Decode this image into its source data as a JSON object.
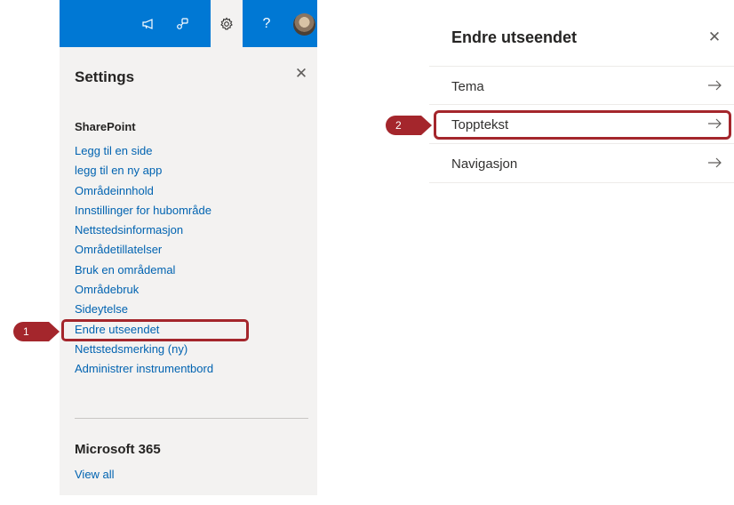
{
  "settings_panel": {
    "title": "Settings",
    "close_glyph": "✕",
    "toolbar": {
      "icons": [
        "megaphone-icon",
        "network-icon",
        "gear-icon",
        "help-icon",
        "avatar"
      ],
      "help_glyph": "?"
    },
    "sharepoint": {
      "title": "SharePoint",
      "links": [
        "Legg til en side",
        "legg til en ny app",
        "Områdeinnhold",
        "Innstillinger for hubområde",
        "Nettstedsinformasjon",
        "Områdetillatelser",
        "Bruk en områdemal",
        "Områdebruk",
        "Sideytelse",
        "Endre utseendet",
        "Nettstedsmerking (ny)",
        "Administrer instrumentbord"
      ]
    },
    "microsoft365": {
      "title": "Microsoft 365",
      "view_all": "View all"
    }
  },
  "change_look_panel": {
    "title": "Endre utseendet",
    "close_glyph": "✕",
    "items": [
      {
        "label": "Tema"
      },
      {
        "label": "Topptekst"
      },
      {
        "label": "Navigasjon"
      }
    ]
  },
  "callouts": {
    "step1": "1",
    "step2": "2",
    "color": "#a4262c"
  },
  "colors": {
    "suite_bar": "#0078d4",
    "link": "#0063b1",
    "panel_bg": "#f3f2f1"
  }
}
